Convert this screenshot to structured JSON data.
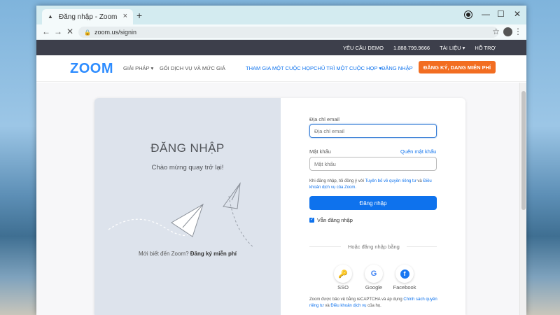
{
  "browser": {
    "tab_title": "Đăng nhập - Zoom",
    "tab_close": "×",
    "new_tab": "+",
    "url": "zoom.us/signin",
    "back": "←",
    "forward": "→",
    "reload": "✕",
    "minimize": "—",
    "maximize": "☐",
    "close": "✕"
  },
  "topbar": {
    "demo": "YÊU CẦU DEMO",
    "phone": "1.888.799.9666",
    "resources": "TÀI LIỆU ▾",
    "support": "HỖ TRỢ"
  },
  "mainnav": {
    "logo": "ZOOM",
    "solutions": "GIẢI PHÁP ▾",
    "plans": "GÓI DỊCH VỤ VÀ MỨC GIÁ",
    "join": "THAM GIA MỘT CUỘC HỌP",
    "host": "CHỦ TRÌ MỘT CUỘC HỌP ▾",
    "signin": "ĐĂNG NHẬP",
    "signup": "ĐĂNG KÝ, DANG MIỄN PHÍ"
  },
  "left_panel": {
    "title": "ĐĂNG NHẬP",
    "subtitle": "Chào mừng quay trở lại!",
    "new_to_zoom": "Mới biết đến Zoom?",
    "signup_free": "Đăng ký miễn phí"
  },
  "form": {
    "email_label": "Địa chỉ email",
    "email_placeholder": "Địa chỉ email",
    "password_label": "Mật khẩu",
    "password_placeholder": "Mật khẩu",
    "forgot": "Quên mật khẩu",
    "terms_prefix": "Khi đăng nhập, tôi đồng ý với",
    "terms_privacy": "Tuyên bố về quyền riêng tư",
    "terms_and": "và",
    "terms_service": "Điều khoản dịch vụ của Zoom.",
    "login_button": "Đăng nhập",
    "stay_signed_in": "Vẫn đăng nhập",
    "or_sign_in_with": "Hoặc đăng nhập bằng",
    "sso": "SSO",
    "google": "Google",
    "facebook": "Facebook",
    "captcha_prefix": "Zoom được bảo vệ bằng reCAPTCHA và áp dụng",
    "captcha_privacy": "Chính sách quyền riêng tư",
    "captcha_and": "và",
    "captcha_terms": "Điều khoản dịch vụ",
    "captcha_suffix": "của họ."
  },
  "colors": {
    "zoom_blue": "#2d8cff",
    "primary_blue": "#0e72ed",
    "signup_orange": "#f26d21",
    "topbar_dark": "#3d3f4b"
  }
}
